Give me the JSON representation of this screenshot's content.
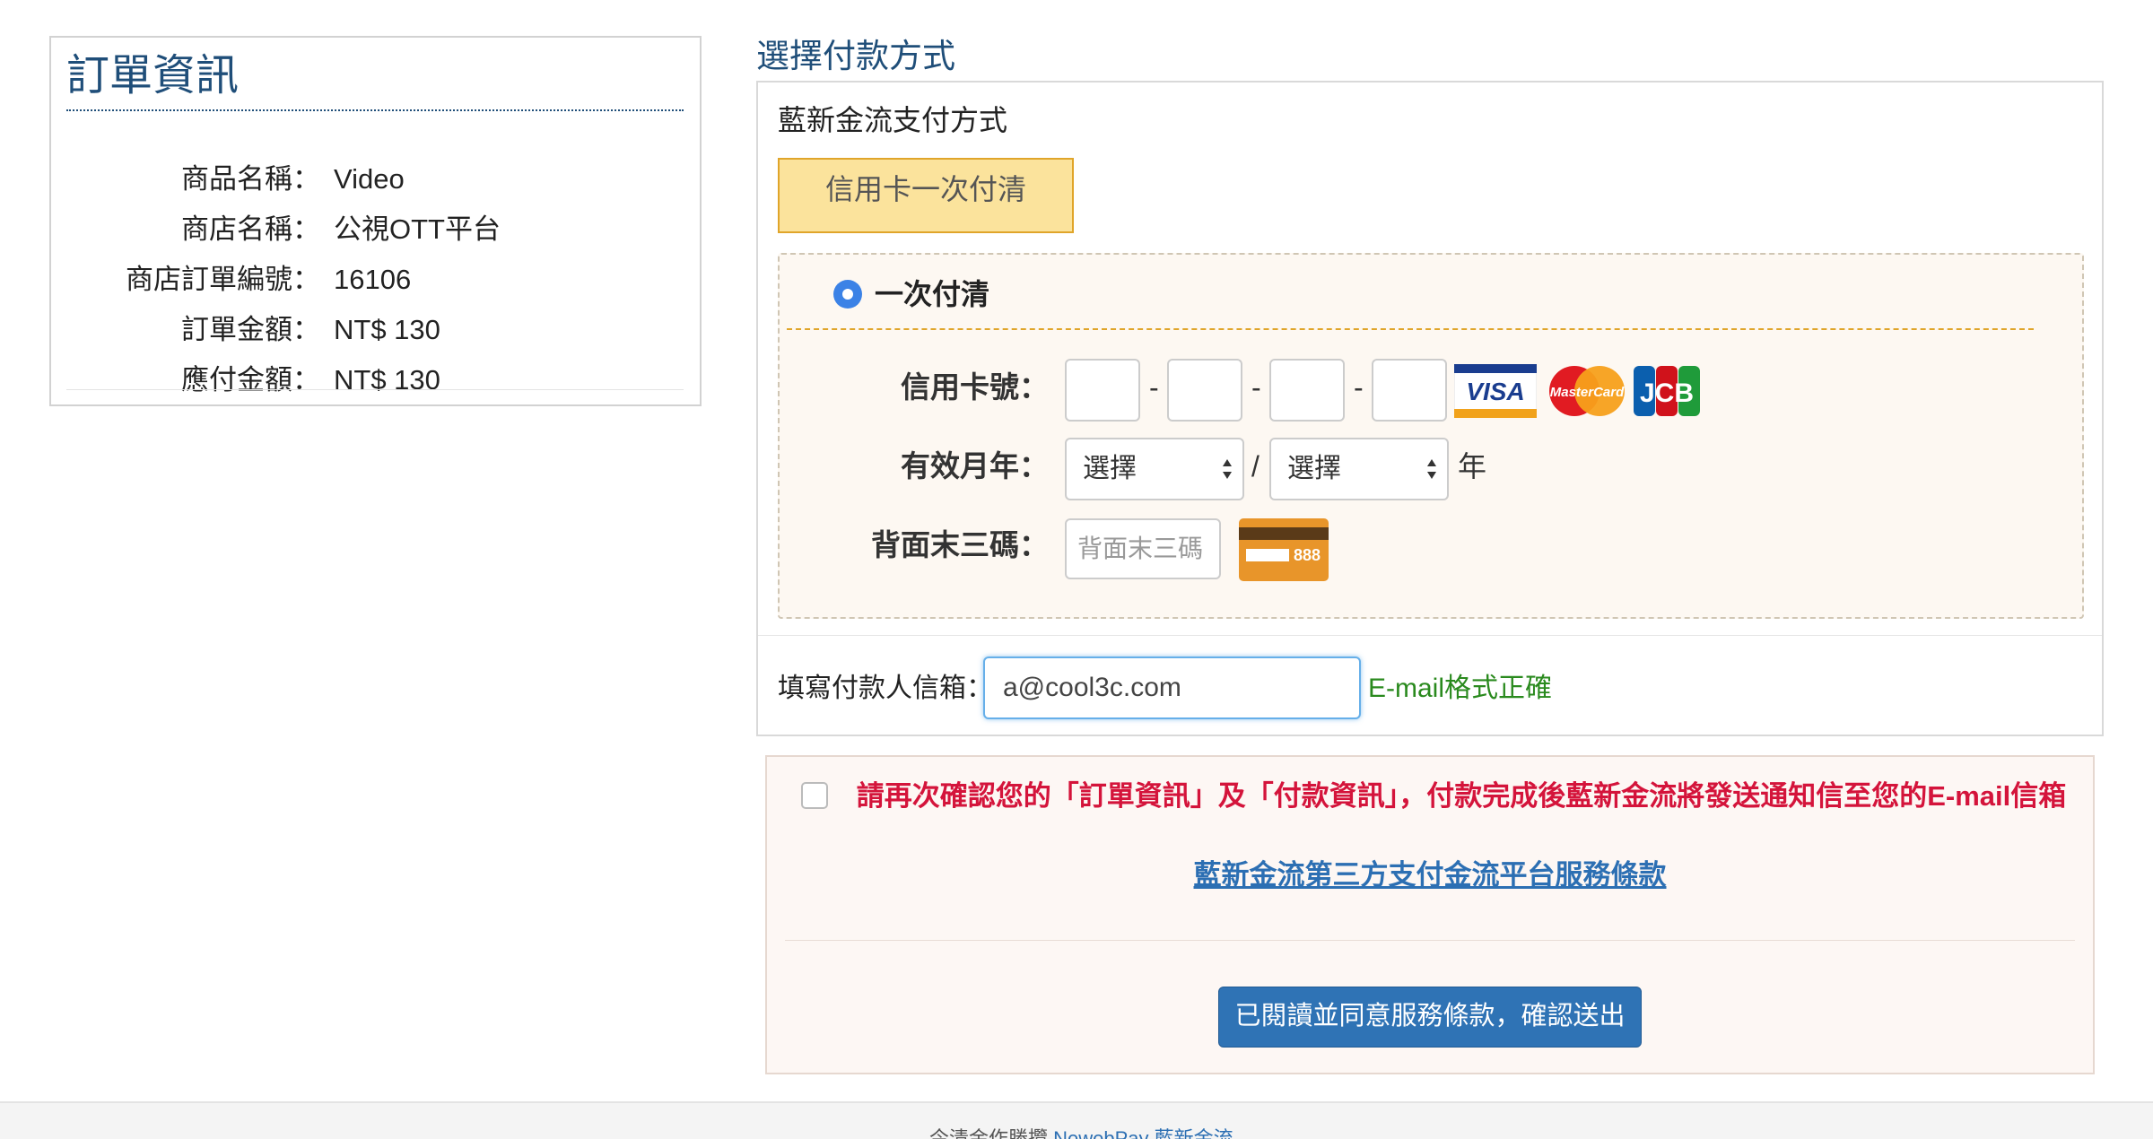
{
  "order": {
    "title": "訂單資訊",
    "rows": [
      {
        "label": "商品名稱：",
        "value": "Video"
      },
      {
        "label": "商店名稱：",
        "value": "公視OTT平台"
      },
      {
        "label": "商店訂單編號：",
        "value": "16106"
      },
      {
        "label": "訂單金額：",
        "value": "NT$ 130"
      },
      {
        "label": "應付金額：",
        "value": "NT$ 130"
      }
    ]
  },
  "payment": {
    "heading": "選擇付款方式",
    "subheading": "藍新金流支付方式",
    "tab_label": "信用卡一次付清",
    "option_label": "一次付清",
    "card_number_label": "信用卡號：",
    "expiry_label": "有效月年：",
    "month_select": "選擇",
    "year_select": "選擇",
    "slash": "/",
    "year_suffix": "年",
    "cvc_label": "背面末三碼：",
    "cvc_placeholder": "背面末三碼",
    "cvc_card_text": "888",
    "dash": "-",
    "logos": {
      "visa": "VISA",
      "mastercard": "MasterCard",
      "jcb": "JCB"
    }
  },
  "email": {
    "label": "填寫付款人信箱：",
    "value": "a@cool3c.com",
    "status": "E-mail格式正確",
    "status_color": "#2a8a1e"
  },
  "confirm": {
    "text": "請再次確認您的「訂單資訊」及「付款資訊」，付款完成後藍新金流將發送通知信至您的E-mail信箱",
    "terms_link": "藍新金流第三方支付金流平台服務條款",
    "submit_label": "已閱讀並同意服務條款，確認送出"
  },
  "footer": {
    "prefix": "今清金作勝攬",
    "brand": "NewebPay 藍新金流"
  },
  "colors": {
    "accent": "#1f4e79",
    "tab_bg": "#fbe39c",
    "alert": "#d4143b",
    "button": "#2f73b5"
  }
}
